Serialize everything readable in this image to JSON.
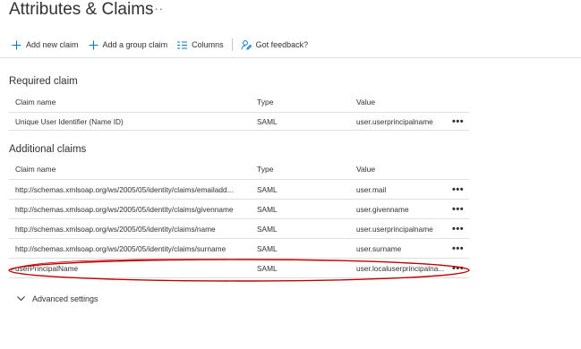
{
  "header": {
    "title": "Attributes & Claims",
    "more": "···"
  },
  "toolbar": {
    "add_new_claim": "Add new claim",
    "add_group_claim": "Add a group claim",
    "columns": "Columns",
    "feedback": "Got feedback?"
  },
  "required": {
    "heading": "Required claim",
    "columns": [
      "Claim name",
      "Type",
      "Value"
    ],
    "rows": [
      {
        "name": "Unique User Identifier (Name ID)",
        "type": "SAML",
        "value": "user.userprincipalname"
      }
    ]
  },
  "additional": {
    "heading": "Additional claims",
    "columns": [
      "Claim name",
      "Type",
      "Value"
    ],
    "rows": [
      {
        "name": "http://schemas.xmlsoap.org/ws/2005/05/identity/claims/emailadd...",
        "type": "SAML",
        "value": "user.mail"
      },
      {
        "name": "http://schemas.xmlsoap.org/ws/2005/05/identity/claims/givenname",
        "type": "SAML",
        "value": "user.givenname"
      },
      {
        "name": "http://schemas.xmlsoap.org/ws/2005/05/identity/claims/name",
        "type": "SAML",
        "value": "user.userprincipalname"
      },
      {
        "name": "http://schemas.xmlsoap.org/ws/2005/05/identity/claims/surname",
        "type": "SAML",
        "value": "user.surname"
      },
      {
        "name": "userPrincipalName",
        "type": "SAML",
        "value": "user.localuserprincipalna..."
      }
    ]
  },
  "row_more": "•••",
  "advanced": {
    "label": "Advanced settings"
  },
  "colors": {
    "accent": "#0078d4",
    "highlight_ellipse": "#c00000"
  }
}
